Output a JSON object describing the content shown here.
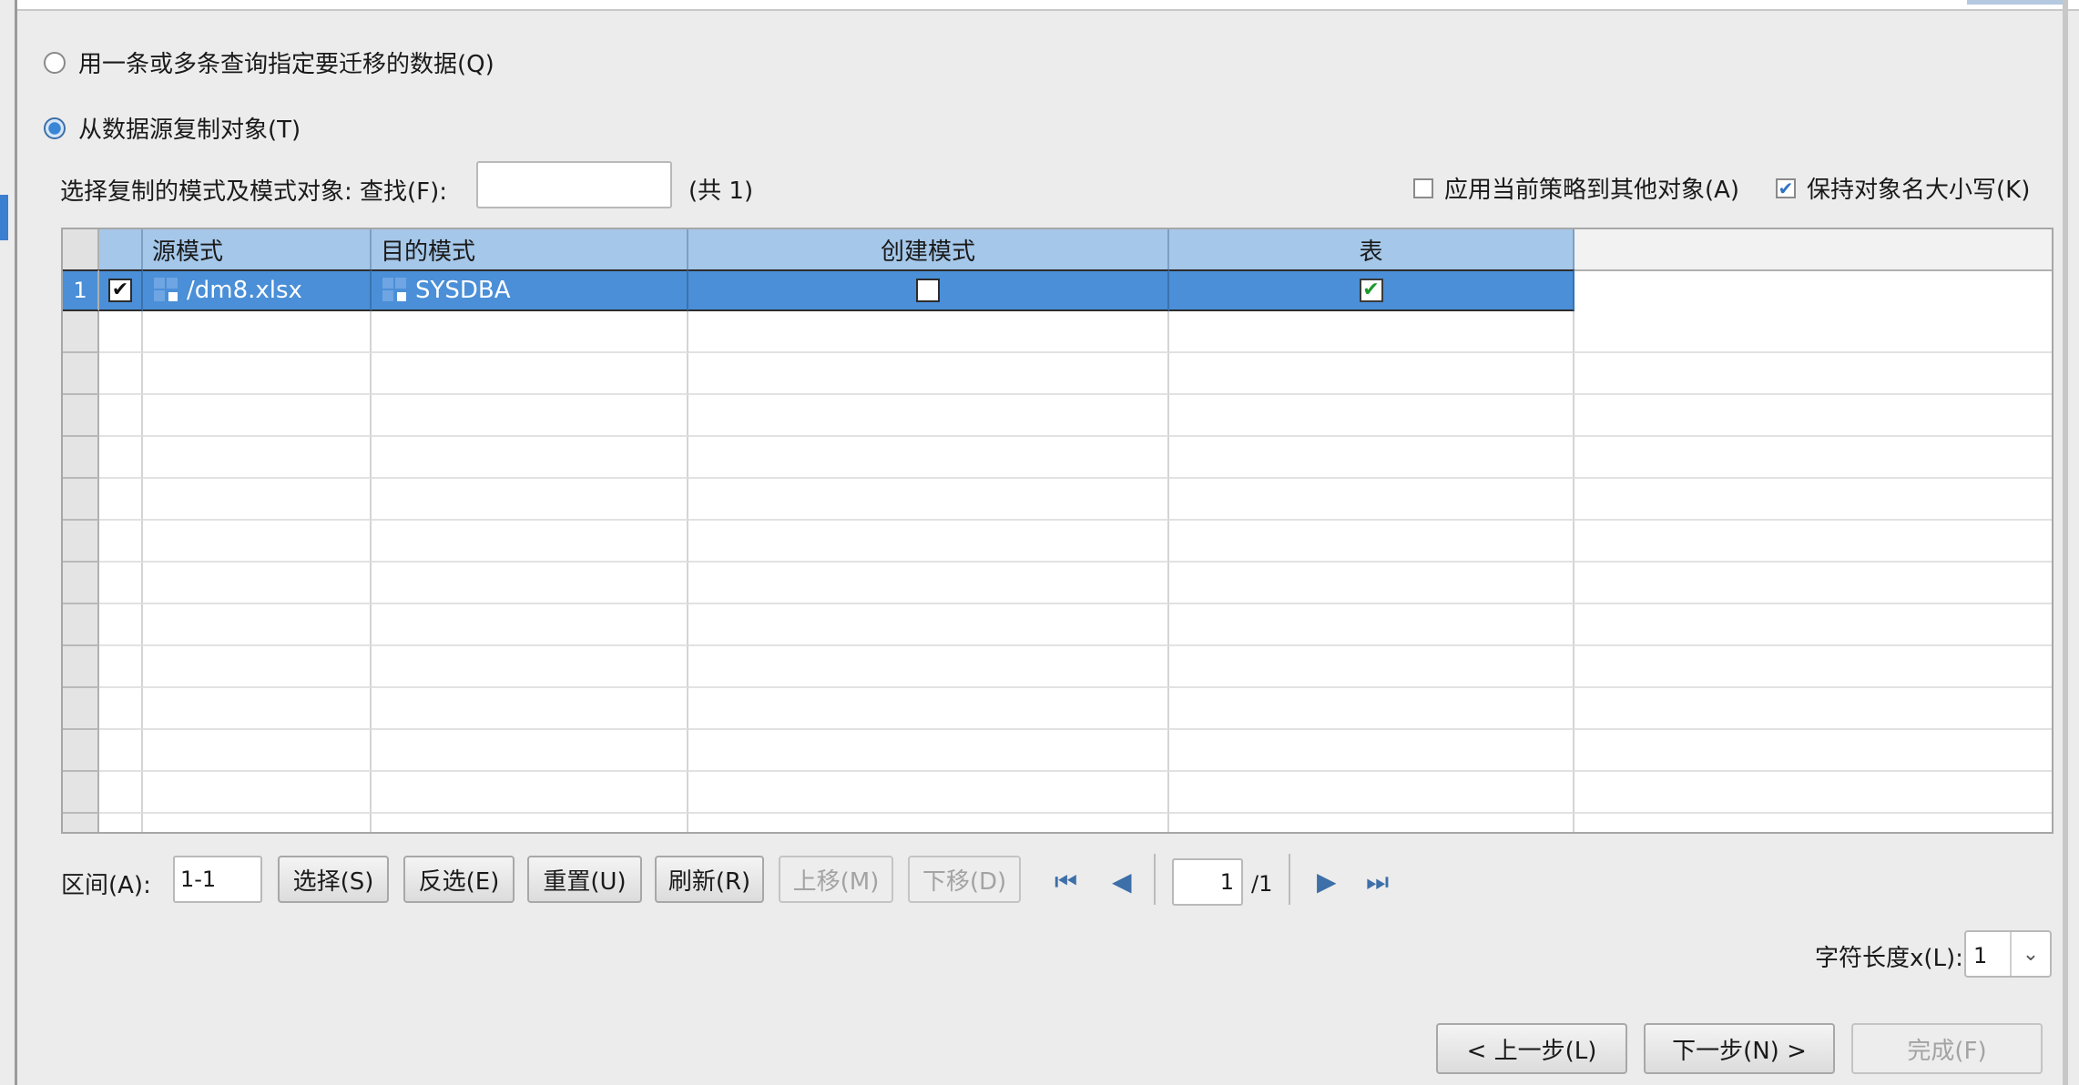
{
  "options": {
    "query_mode": {
      "label": "用一条或多条查询指定要迁移的数据(Q)",
      "selected": false
    },
    "copy_mode": {
      "label": "从数据源复制对象(T)",
      "selected": true
    }
  },
  "find": {
    "label": "选择复制的模式及模式对象: 查找(F):",
    "value": "",
    "count": "(共 1)"
  },
  "checkboxes": {
    "apply_policy": {
      "label": "应用当前策略到其他对象(A)",
      "checked": false
    },
    "keep_case": {
      "label": "保持对象名大小写(K)",
      "checked": true
    }
  },
  "table": {
    "headers": [
      "源模式",
      "目的模式",
      "创建模式",
      "表"
    ],
    "rows": [
      {
        "num": "1",
        "checked": true,
        "source": "/dm8.xlsx",
        "target": "SYSDBA",
        "create_schema": false,
        "table": true
      }
    ]
  },
  "range": {
    "label": "区间(A):",
    "value": "1-1"
  },
  "buttons": {
    "select": "选择(S)",
    "invert": "反选(E)",
    "reset": "重置(U)",
    "refresh": "刷新(R)",
    "move_up": "上移(M)",
    "move_down": "下移(D)"
  },
  "pager": {
    "current": "1",
    "total": "/1"
  },
  "char_length": {
    "label": "字符长度x(L):",
    "value": "1"
  },
  "footer": {
    "prev": "< 上一步(L)",
    "next": "下一步(N) >",
    "finish": "完成(F)"
  },
  "colors": {
    "header": "#a5c7e9",
    "selected_row": "#4a8fd7",
    "accent": "#3a7fd0"
  }
}
